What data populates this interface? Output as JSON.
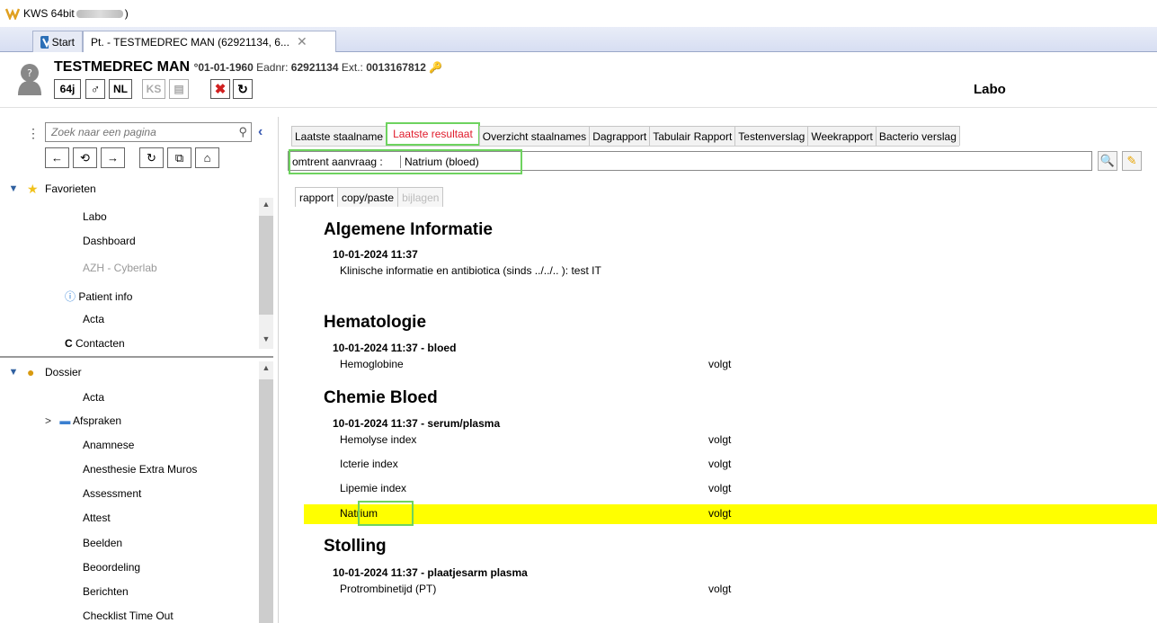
{
  "window": {
    "title": "KWS 64bit",
    "title_suffix": ")"
  },
  "tabs": [
    {
      "label": "Start"
    },
    {
      "label": "Pt. - TESTMEDREC MAN  (62921134, 6..."
    }
  ],
  "patient": {
    "name": "TESTMEDREC MAN",
    "dob": "°01-01-1960",
    "eadnr_label": "Eadnr:",
    "eadnr": "62921134",
    "ext_label": "Ext.:",
    "ext": "0013167812",
    "age": "64j",
    "sex": "♂",
    "lang": "NL",
    "ks": "KS"
  },
  "page_title": "Labo",
  "sidebar": {
    "search_placeholder": "Zoek naar een pagina",
    "favorites": {
      "title": "Favorieten",
      "items": [
        "Labo",
        "Dashboard",
        "AZH - Cyberlab",
        "Patient info",
        "Acta",
        "Contacten"
      ]
    },
    "dossier": {
      "title": "Dossier",
      "items": [
        "Acta",
        "Afspraken",
        "Anamnese",
        "Anesthesie Extra Muros",
        "Assessment",
        "Attest",
        "Beelden",
        "Beoordeling",
        "Berichten",
        "Checklist Time Out"
      ]
    }
  },
  "result_tabs": [
    "Laatste staalname",
    "Laatste resultaat",
    "Overzicht staalnames",
    "Dagrapport",
    "Tabulair Rapport",
    "Testenverslag",
    "Weekrapport",
    "Bacterio verslag"
  ],
  "query": {
    "label": "omtrent aanvraag :",
    "value": "Natrium (bloed)"
  },
  "sub_tabs": [
    "rapport",
    "copy/paste",
    "bijlagen"
  ],
  "report": {
    "sections": [
      {
        "title": "Algemene Informatie",
        "sub": "10-01-2024 11:37",
        "rows": [
          {
            "name": "Klinische informatie en antibiotica (sinds ../../.. ): test IT",
            "value": ""
          }
        ]
      },
      {
        "title": "Hematologie",
        "sub": "10-01-2024 11:37 - bloed",
        "rows": [
          {
            "name": "Hemoglobine",
            "value": "volgt"
          }
        ]
      },
      {
        "title": "Chemie Bloed",
        "sub": "10-01-2024 11:37 - serum/plasma",
        "rows": [
          {
            "name": "Hemolyse index",
            "value": "volgt"
          },
          {
            "name": "Icterie index",
            "value": "volgt"
          },
          {
            "name": "Lipemie index",
            "value": "volgt"
          },
          {
            "name": "Natrium",
            "value": "volgt"
          }
        ]
      },
      {
        "title": "Stolling",
        "sub": "10-01-2024 11:37 - plaatjesarm plasma",
        "rows": [
          {
            "name": "Protrombinetijd (PT)",
            "value": "volgt"
          }
        ]
      }
    ]
  }
}
